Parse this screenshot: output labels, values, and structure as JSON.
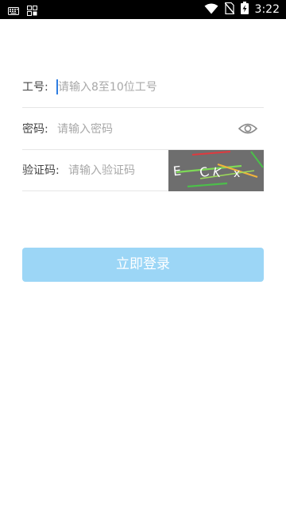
{
  "status_bar": {
    "time": "3:22",
    "icons": [
      "keyboard-icon",
      "app-grid-icon",
      "wifi-icon",
      "no-sim-icon",
      "battery-charging-icon"
    ]
  },
  "form": {
    "employee_id": {
      "label": "工号:",
      "placeholder": "请输入8至10位工号",
      "value": ""
    },
    "password": {
      "label": "密码:",
      "placeholder": "请输入密码",
      "value": "",
      "toggle_icon": "eye-icon"
    },
    "captcha": {
      "label": "验证码:",
      "placeholder": "请输入验证码",
      "value": "",
      "image_chars": [
        "E",
        "C",
        "K",
        "x"
      ]
    }
  },
  "login_button": {
    "label": "立即登录"
  },
  "colors": {
    "button_background": "#9cd6f6",
    "cursor": "#2f7de1",
    "captcha_background": "#6e6e6e"
  }
}
